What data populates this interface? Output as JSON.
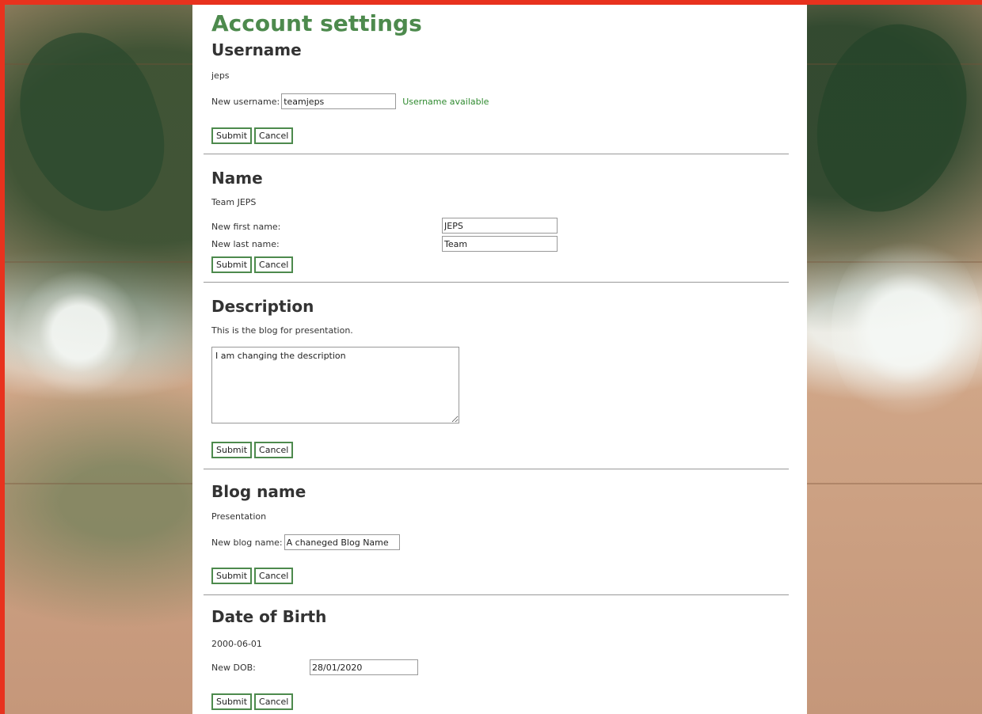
{
  "page": {
    "title": "Account settings"
  },
  "buttons": {
    "submit": "Submit",
    "cancel": "Cancel"
  },
  "username": {
    "heading": "Username",
    "current": "jeps",
    "new_label": "New username:",
    "new_value": "teamjeps",
    "status": "Username available",
    "status_color": "#2f8a2f"
  },
  "name": {
    "heading": "Name",
    "current": "Team JEPS",
    "first_label": "New first name:",
    "first_value": "JEPS",
    "last_label": "New last name:",
    "last_value": "Team"
  },
  "description": {
    "heading": "Description",
    "current": "This is the blog for presentation.",
    "new_value": "I am changing the description"
  },
  "blog_name": {
    "heading": "Blog name",
    "current": "Presentation",
    "new_label": "New blog name:",
    "new_value": "A chaneged Blog Name"
  },
  "dob": {
    "heading": "Date of Birth",
    "current": "2000-06-01",
    "new_label": "New DOB:",
    "new_value": "28/01/2020"
  },
  "colors": {
    "accent": "#4d8a4d",
    "border": "#e8321e"
  }
}
